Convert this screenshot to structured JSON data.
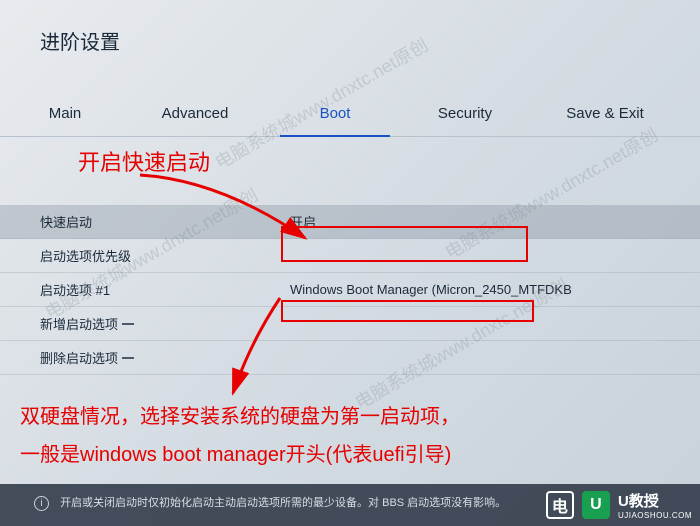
{
  "header": {
    "title": "进阶设置"
  },
  "tabs": {
    "main": "Main",
    "advanced": "Advanced",
    "boot": "Boot",
    "security": "Security",
    "save": "Save & Exit",
    "active": "boot"
  },
  "annotations": {
    "fast_boot_hint": "开启快速启动",
    "dual_disk_line1": "双硬盘情况，选择安装系统的硬盘为第一启动项，",
    "dual_disk_line2": "一般是windows boot manager开头(代表uefi引导)"
  },
  "rows": {
    "fast_boot": {
      "label": "快速启动",
      "value": "开启"
    },
    "priority": {
      "label": "启动选项优先级"
    },
    "option1": {
      "label": "启动选项 #1",
      "value": "Windows Boot Manager (Micron_2450_MTFDKB"
    },
    "add_option": {
      "label": "新增启动选项"
    },
    "del_option": {
      "label": "删除启动选项"
    }
  },
  "footer": {
    "text": "开启或关闭启动时仅初始化启动主动启动选项所需的最少设备。对 BBS 启动选项没有影响。"
  },
  "watermark": "电脑系统城www.dnxtc.net原创",
  "brand": {
    "logo_letter": "电",
    "name": "U教授",
    "url": "UJIAOSHOU.COM",
    "u": "U"
  }
}
